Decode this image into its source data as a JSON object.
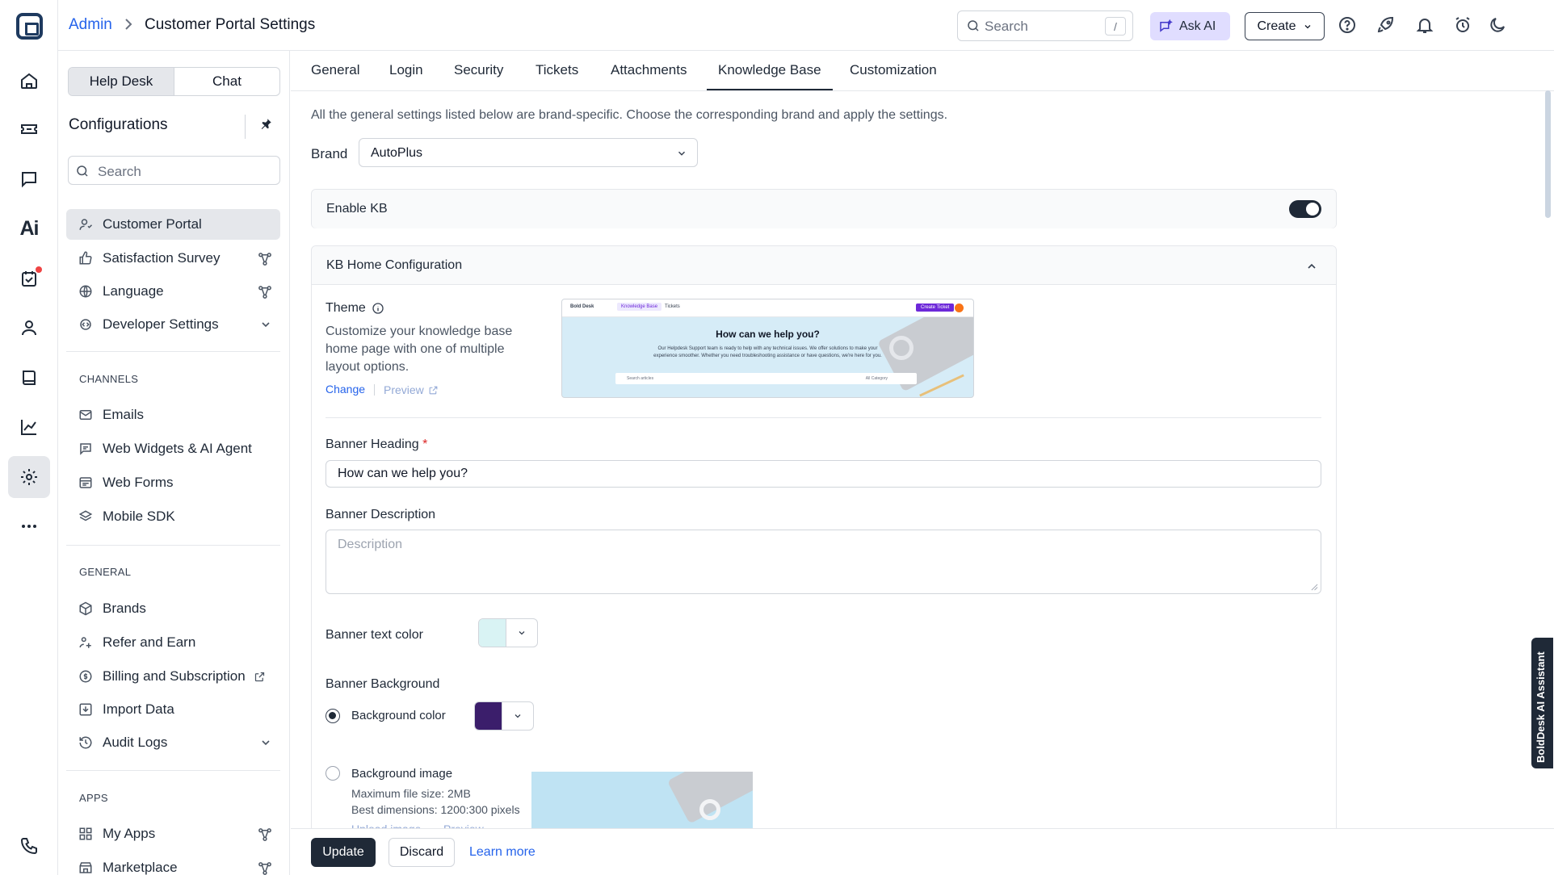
{
  "header": {
    "breadcrumb_root": "Admin",
    "breadcrumb_current": "Customer Portal Settings",
    "search_placeholder": "Search",
    "search_shortcut": "/",
    "ask_ai_label": "Ask AI",
    "create_label": "Create"
  },
  "sidebar": {
    "segment_tabs": [
      "Help Desk",
      "Chat"
    ],
    "title": "Configurations",
    "search_placeholder": "Search",
    "items": [
      {
        "label": "Customer Portal"
      },
      {
        "label": "Satisfaction Survey"
      },
      {
        "label": "Language"
      },
      {
        "label": "Developer Settings"
      }
    ],
    "channels_label": "CHANNELS",
    "channels": [
      {
        "label": "Emails"
      },
      {
        "label": "Web Widgets & AI Agent"
      },
      {
        "label": "Web Forms"
      },
      {
        "label": "Mobile SDK"
      }
    ],
    "general_label": "GENERAL",
    "general": [
      {
        "label": "Brands"
      },
      {
        "label": "Refer and Earn"
      },
      {
        "label": "Billing and Subscription"
      },
      {
        "label": "Import Data"
      },
      {
        "label": "Audit Logs"
      }
    ],
    "apps_label": "APPS",
    "apps": [
      {
        "label": "My Apps"
      },
      {
        "label": "Marketplace"
      }
    ]
  },
  "tabs": [
    "General",
    "Login",
    "Security",
    "Tickets",
    "Attachments",
    "Knowledge Base",
    "Customization"
  ],
  "main": {
    "intro": "All the general settings listed below are brand-specific. Choose the corresponding brand and apply the settings.",
    "brand_label": "Brand",
    "brand_value": "AutoPlus",
    "enable_kb_label": "Enable KB",
    "enable_kb_on": true,
    "kb_home_title": "KB Home Configuration",
    "theme_label": "Theme",
    "theme_desc": "Customize your knowledge base home page with one of multiple layout options.",
    "change_link": "Change",
    "preview_link": "Preview",
    "theme_preview": {
      "logo": "Bold Desk",
      "tab_kb": "Knowledge Base",
      "tab_tickets": "Tickets",
      "button": "Create Ticket",
      "heading": "How can we help you?",
      "sub": "Our Helpdesk Support team is ready to help with any technical issues. We offer solutions to make your experience smoother. Whether you need troubleshooting assistance or have questions, we're here for you.",
      "search_ph": "Search articles",
      "category": "All Category"
    },
    "banner_heading_label": "Banner Heading",
    "banner_heading_value": "How can we help you?",
    "banner_desc_label": "Banner Description",
    "banner_desc_placeholder": "Description",
    "banner_text_color_label": "Banner text color",
    "banner_text_color": "#d9f3f4",
    "banner_bg_label": "Banner Background",
    "bg_color_label": "Background color",
    "bg_color": "#3b1e6b",
    "bg_image_label": "Background image",
    "bg_image_size": "Maximum file size: 2MB",
    "bg_image_dims": "Best dimensions: 1200:300 pixels",
    "upload_link": "Upload image",
    "bg_preview_link": "Preview"
  },
  "footer": {
    "update_label": "Update",
    "discard_label": "Discard",
    "learn_more_label": "Learn more"
  },
  "ai_assistant_label": "BoldDesk AI Assistant"
}
